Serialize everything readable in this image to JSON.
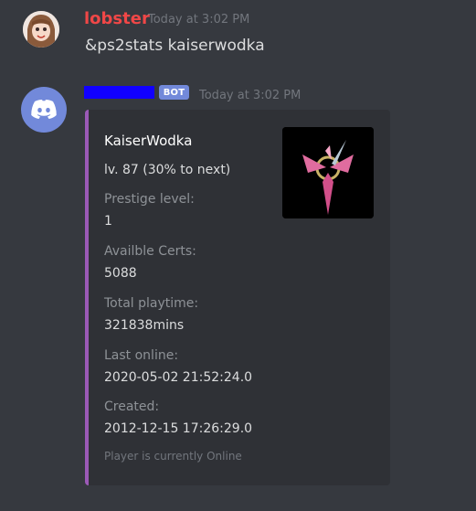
{
  "user_message": {
    "username": "lobster",
    "timestamp": "Today at 3:02 PM",
    "content": "&ps2stats kaiserwodka"
  },
  "bot_message": {
    "badge": "BOT",
    "timestamp": "Today at 3:02 PM",
    "embed": {
      "title": "KaiserWodka",
      "description": "lv. 87 (30% to next)",
      "fields": [
        {
          "name": "Prestige level:",
          "value": "1"
        },
        {
          "name": "Availble Certs:",
          "value": "5088"
        },
        {
          "name": "Total playtime:",
          "value": "321838mins"
        },
        {
          "name": "Last online:",
          "value": "2020-05-02 21:52:24.0"
        },
        {
          "name": "Created:",
          "value": "2012-12-15 17:26:29.0"
        }
      ],
      "footer": "Player is currently Online"
    }
  },
  "colors": {
    "background": "#36393f",
    "username": "#f04747",
    "embed_accent": "#9b59b6",
    "bot_badge": "#7289da",
    "redaction": "#1100ff"
  }
}
